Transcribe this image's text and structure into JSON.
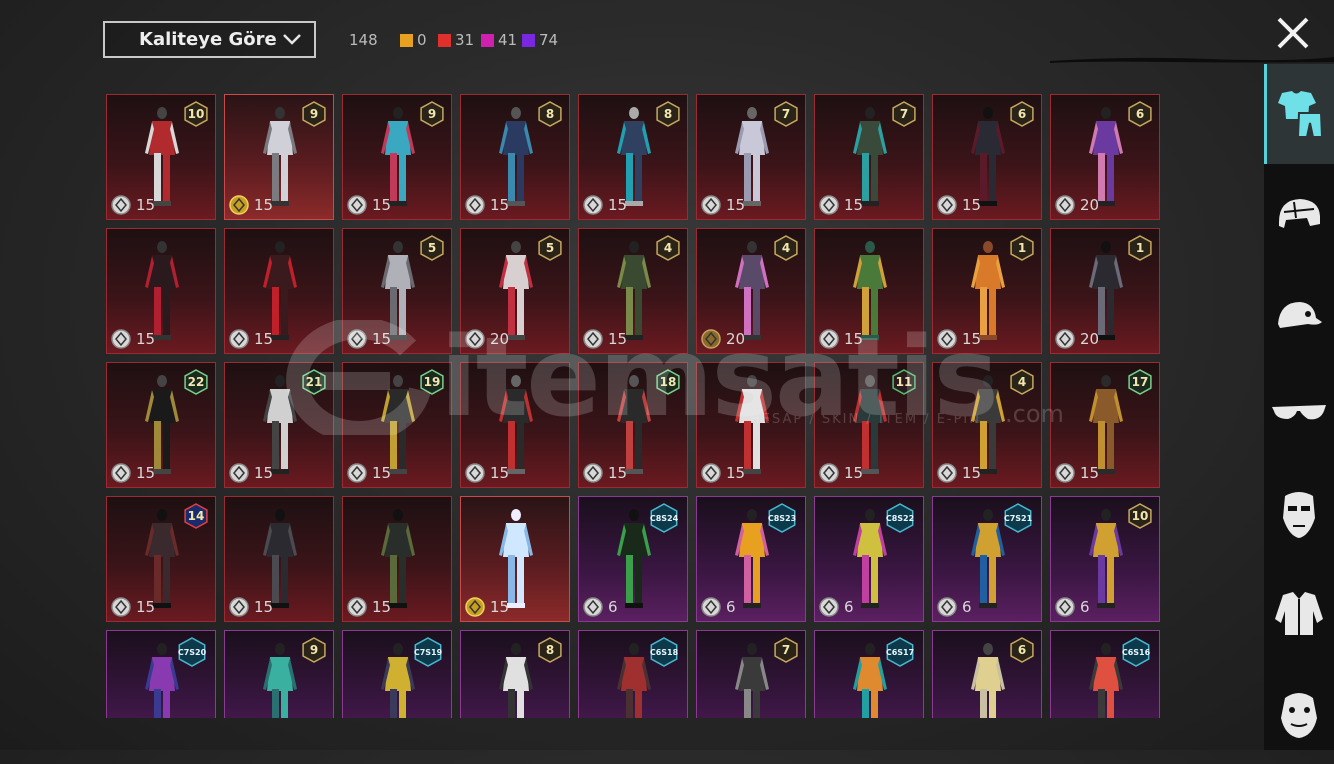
{
  "toolbar": {
    "sort_label": "Kaliteye Göre",
    "total_count": "148",
    "rarity_counts": [
      {
        "color": "#e8a020",
        "count": "0"
      },
      {
        "color": "#e0302c",
        "count": "31"
      },
      {
        "color": "#d020b0",
        "count": "41"
      },
      {
        "color": "#7a28e0",
        "count": "74"
      }
    ]
  },
  "watermark": {
    "brand": "itemsatis",
    "tagline": "HESAP / SKIN / ITEM / E-PIN",
    "domain": ".com"
  },
  "items": [
    {
      "badge": "10",
      "price": "15",
      "coin": "silver",
      "tier": "red"
    },
    {
      "badge": "9",
      "price": "15",
      "coin": "gold",
      "tier": "highlight"
    },
    {
      "badge": "9",
      "price": "15",
      "coin": "silver",
      "tier": "red"
    },
    {
      "badge": "8",
      "price": "15",
      "coin": "silver",
      "tier": "red"
    },
    {
      "badge": "8",
      "price": "15",
      "coin": "silver",
      "tier": "red"
    },
    {
      "badge": "7",
      "price": "15",
      "coin": "silver",
      "tier": "red"
    },
    {
      "badge": "7",
      "price": "15",
      "coin": "silver",
      "tier": "red"
    },
    {
      "badge": "6",
      "price": "15",
      "coin": "silver",
      "tier": "red"
    },
    {
      "badge": "6",
      "price": "20",
      "coin": "silver",
      "tier": "red"
    },
    {
      "badge": "",
      "price": "15",
      "coin": "silver",
      "tier": "red"
    },
    {
      "badge": "",
      "price": "15",
      "coin": "silver",
      "tier": "red"
    },
    {
      "badge": "5",
      "price": "15",
      "coin": "silver",
      "tier": "red"
    },
    {
      "badge": "5",
      "price": "20",
      "coin": "silver",
      "tier": "red"
    },
    {
      "badge": "4",
      "price": "15",
      "coin": "silver",
      "tier": "red"
    },
    {
      "badge": "4",
      "price": "20",
      "coin": "bronze",
      "tier": "red"
    },
    {
      "badge": "",
      "price": "15",
      "coin": "silver",
      "tier": "red"
    },
    {
      "badge": "1",
      "price": "15",
      "coin": "silver",
      "tier": "red"
    },
    {
      "badge": "1",
      "price": "20",
      "coin": "silver",
      "tier": "red"
    },
    {
      "badge": "22",
      "price": "15",
      "coin": "silver",
      "tier": "red"
    },
    {
      "badge": "21",
      "price": "15",
      "coin": "silver",
      "tier": "red"
    },
    {
      "badge": "19",
      "price": "15",
      "coin": "silver",
      "tier": "red"
    },
    {
      "badge": "",
      "price": "15",
      "coin": "silver",
      "tier": "red"
    },
    {
      "badge": "18",
      "price": "15",
      "coin": "silver",
      "tier": "red"
    },
    {
      "badge": "",
      "price": "15",
      "coin": "silver",
      "tier": "red"
    },
    {
      "badge": "11",
      "price": "15",
      "coin": "silver",
      "tier": "red"
    },
    {
      "badge": "4",
      "price": "15",
      "coin": "silver",
      "tier": "red"
    },
    {
      "badge": "17",
      "price": "15",
      "coin": "silver",
      "tier": "red"
    },
    {
      "badge": "14",
      "price": "15",
      "coin": "silver",
      "tier": "red"
    },
    {
      "badge": "",
      "price": "15",
      "coin": "silver",
      "tier": "red"
    },
    {
      "badge": "",
      "price": "15",
      "coin": "silver",
      "tier": "red"
    },
    {
      "badge": "",
      "price": "15",
      "coin": "gold",
      "tier": "highlight"
    },
    {
      "badge": "C8S24",
      "price": "6",
      "coin": "silver",
      "tier": "purple"
    },
    {
      "badge": "C8S23",
      "price": "6",
      "coin": "silver",
      "tier": "purple"
    },
    {
      "badge": "C8S22",
      "price": "6",
      "coin": "silver",
      "tier": "purple"
    },
    {
      "badge": "C7S21",
      "price": "6",
      "coin": "silver",
      "tier": "purple"
    },
    {
      "badge": "10",
      "price": "6",
      "coin": "silver",
      "tier": "purple"
    },
    {
      "badge": "C7S20",
      "price": "",
      "coin": "",
      "tier": "purple"
    },
    {
      "badge": "9",
      "price": "",
      "coin": "",
      "tier": "purple"
    },
    {
      "badge": "C7S19",
      "price": "",
      "coin": "",
      "tier": "purple"
    },
    {
      "badge": "8",
      "price": "",
      "coin": "",
      "tier": "purple"
    },
    {
      "badge": "C6S18",
      "price": "",
      "coin": "",
      "tier": "purple"
    },
    {
      "badge": "7",
      "price": "",
      "coin": "",
      "tier": "purple"
    },
    {
      "badge": "C6S17",
      "price": "",
      "coin": "",
      "tier": "purple"
    },
    {
      "badge": "6",
      "price": "",
      "coin": "",
      "tier": "purple"
    },
    {
      "badge": "C6S16",
      "price": "",
      "coin": "",
      "tier": "purple"
    }
  ],
  "sidebar_tabs": [
    {
      "icon": "outfit-icon",
      "active": true
    },
    {
      "icon": "helmet-icon",
      "active": false
    },
    {
      "icon": "cap-icon",
      "active": false
    },
    {
      "icon": "glasses-icon",
      "active": false
    },
    {
      "icon": "mask-icon",
      "active": false
    },
    {
      "icon": "jacket-icon",
      "active": false
    },
    {
      "icon": "face-icon",
      "active": false
    }
  ]
}
